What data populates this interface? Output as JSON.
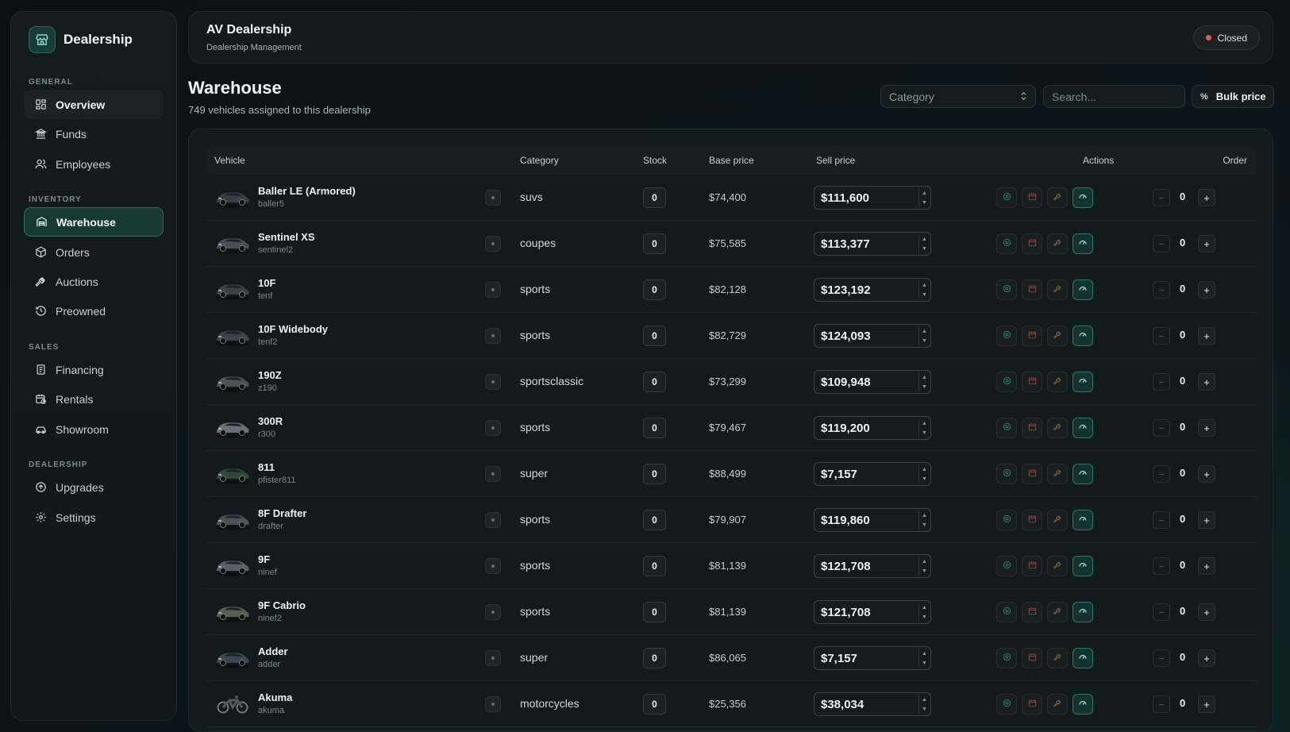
{
  "sidebar": {
    "brand": "Dealership",
    "sections": {
      "general": "GENERAL",
      "inventory": "INVENTORY",
      "sales": "SALES",
      "dealership": "DEALERSHIP"
    },
    "items": {
      "overview": "Overview",
      "funds": "Funds",
      "employees": "Employees",
      "warehouse": "Warehouse",
      "orders": "Orders",
      "auctions": "Auctions",
      "preowned": "Preowned",
      "financing": "Financing",
      "rentals": "Rentals",
      "showroom": "Showroom",
      "upgrades": "Upgrades",
      "settings": "Settings"
    }
  },
  "header": {
    "title": "AV Dealership",
    "subtitle": "Dealership Management",
    "status": "Closed"
  },
  "page": {
    "title": "Warehouse",
    "subtitle": "749 vehicles assigned to this dealership"
  },
  "controls": {
    "category_placeholder": "Category",
    "search_placeholder": "Search...",
    "bulk_label": "Bulk price",
    "bulk_icon": "%"
  },
  "table": {
    "columns": {
      "vehicle": "Vehicle",
      "category": "Category",
      "stock": "Stock",
      "base": "Base price",
      "sell": "Sell price",
      "actions": "Actions",
      "order": "Order"
    },
    "rows": [
      {
        "name": "Baller LE (Armored)",
        "code": "baller5",
        "category": "suvs",
        "stock": "0",
        "base": "$74,400",
        "sell": "$111,600",
        "order": "0",
        "color": "#3a3f44"
      },
      {
        "name": "Sentinel XS",
        "code": "sentinel2",
        "category": "coupes",
        "stock": "0",
        "base": "$75,585",
        "sell": "$113,377",
        "order": "0",
        "color": "#4a5056"
      },
      {
        "name": "10F",
        "code": "tenf",
        "category": "sports",
        "stock": "0",
        "base": "$82,128",
        "sell": "$123,192",
        "order": "0",
        "color": "#3c4246"
      },
      {
        "name": "10F Widebody",
        "code": "tenf2",
        "category": "sports",
        "stock": "0",
        "base": "$82,729",
        "sell": "$124,093",
        "order": "0",
        "color": "#3c4246"
      },
      {
        "name": "190Z",
        "code": "z190",
        "category": "sportsclassic",
        "stock": "0",
        "base": "$73,299",
        "sell": "$109,948",
        "order": "0",
        "color": "#4c5257"
      },
      {
        "name": "300R",
        "code": "r300",
        "category": "sports",
        "stock": "0",
        "base": "$79,467",
        "sell": "$119,200",
        "order": "0",
        "color": "#6a6e72"
      },
      {
        "name": "811",
        "code": "pfister811",
        "category": "super",
        "stock": "0",
        "base": "$88,499",
        "sell": "$7,157",
        "order": "0",
        "color": "#2f4a3a"
      },
      {
        "name": "8F Drafter",
        "code": "drafter",
        "category": "sports",
        "stock": "0",
        "base": "$79,907",
        "sell": "$119,860",
        "order": "0",
        "color": "#4a5258"
      },
      {
        "name": "9F",
        "code": "ninef",
        "category": "sports",
        "stock": "0",
        "base": "$81,139",
        "sell": "$121,708",
        "order": "0",
        "color": "#5a6066"
      },
      {
        "name": "9F Cabrio",
        "code": "ninef2",
        "category": "sports",
        "stock": "0",
        "base": "$81,139",
        "sell": "$121,708",
        "order": "0",
        "color": "#5c5e4e"
      },
      {
        "name": "Adder",
        "code": "adder",
        "category": "super",
        "stock": "0",
        "base": "$86,065",
        "sell": "$7,157",
        "order": "0",
        "color": "#3a4650"
      },
      {
        "name": "Akuma",
        "code": "akuma",
        "category": "motorcycles",
        "stock": "0",
        "base": "$25,356",
        "sell": "$38,034",
        "order": "0",
        "color": "#555a5e",
        "bike": true
      }
    ]
  },
  "colors": {
    "accent": "#2e7a69",
    "status_closed": "#e05a5a"
  }
}
